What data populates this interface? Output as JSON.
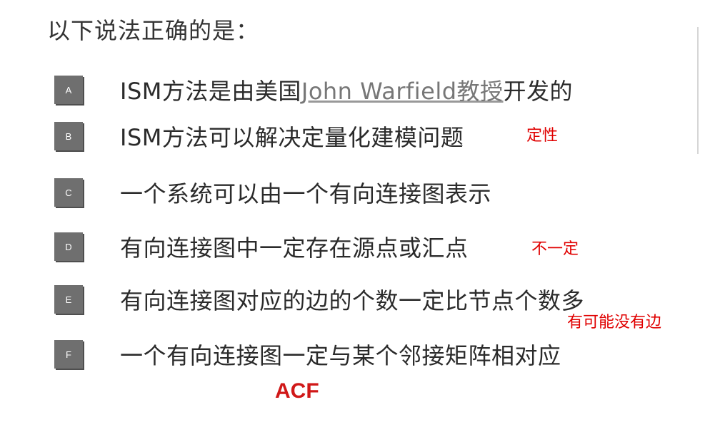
{
  "question": "以下说法正确的是：",
  "options": [
    {
      "letter": "A",
      "text_before": "ISM方法是由美国",
      "link": "John Warfield教授",
      "text_after": "开发的",
      "note": ""
    },
    {
      "letter": "B",
      "text": "ISM方法可以解决定量化建模问题",
      "note": "定性"
    },
    {
      "letter": "C",
      "text": "一个系统可以由一个有向连接图表示",
      "note": ""
    },
    {
      "letter": "D",
      "text": "有向连接图中一定存在源点或汇点",
      "note": "不一定"
    },
    {
      "letter": "E",
      "text": "有向连接图对应的边的个数一定比节点个数多",
      "note": "有可能没有边"
    },
    {
      "letter": "F",
      "text": "一个有向连接图一定与某个邻接矩阵相对应",
      "note": ""
    }
  ],
  "answer": "ACF",
  "colors": {
    "badge": "#6f6f6f",
    "note": "#e00000",
    "answer": "#d01818"
  }
}
